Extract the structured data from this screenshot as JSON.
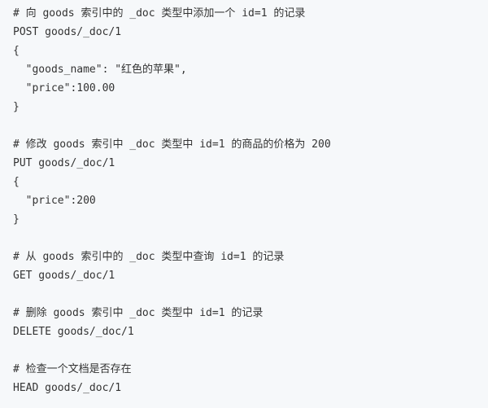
{
  "code_block": {
    "lines": [
      "# 向 goods 索引中的 _doc 类型中添加一个 id=1 的记录",
      "POST goods/_doc/1",
      "{",
      "  \"goods_name\": \"红色的苹果\",",
      "  \"price\":100.00",
      "}",
      "",
      "# 修改 goods 索引中 _doc 类型中 id=1 的商品的价格为 200",
      "PUT goods/_doc/1",
      "{",
      "  \"price\":200",
      "}",
      "",
      "# 从 goods 索引中的 _doc 类型中查询 id=1 的记录",
      "GET goods/_doc/1",
      "",
      "# 删除 goods 索引中 _doc 类型中 id=1 的记录",
      "DELETE goods/_doc/1",
      "",
      "# 检查一个文档是否存在",
      "HEAD goods/_doc/1"
    ]
  }
}
